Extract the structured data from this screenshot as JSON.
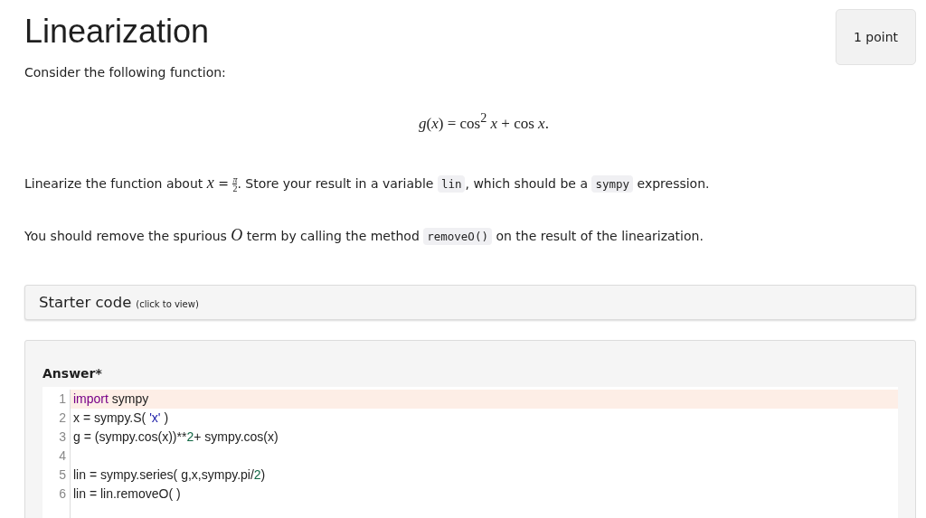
{
  "title": "Linearization",
  "points": "1 point",
  "intro": "Consider the following function:",
  "equation": "*g*(*x*) = cos$^{2}$ *x* + cos *x*.",
  "paragraphs": [
    [
      {
        "kind": "text",
        "text": "Linearize the function about "
      },
      {
        "kind": "math",
        "text": "x"
      },
      {
        "kind": "text",
        "text": " = "
      },
      {
        "kind": "fraction",
        "numerator": "π",
        "denominator": "2"
      },
      {
        "kind": "text",
        "text": ". Store your result in a variable "
      },
      {
        "kind": "code",
        "text": "lin"
      },
      {
        "kind": "text",
        "text": ", which should be a "
      },
      {
        "kind": "code",
        "text": "sympy"
      },
      {
        "kind": "text",
        "text": " expression."
      }
    ],
    [
      {
        "kind": "text",
        "text": "You should remove the spurious "
      },
      {
        "kind": "math",
        "text": "O"
      },
      {
        "kind": "text",
        "text": " term by calling the method "
      },
      {
        "kind": "code",
        "text": "removeO()"
      },
      {
        "kind": "text",
        "text": " on the result of the linearization."
      }
    ]
  ],
  "starter": {
    "title": "Starter code",
    "hint": "(click to view)"
  },
  "answer": {
    "label": "Answer*",
    "lines": [
      {
        "number": "1",
        "active": true,
        "tokens": [
          {
            "kind": "keyword",
            "text": "import"
          },
          {
            "kind": "plain",
            "text": " sympy"
          }
        ]
      },
      {
        "number": "2",
        "active": false,
        "tokens": [
          {
            "kind": "plain",
            "text": "x = sympy.S( "
          },
          {
            "kind": "string",
            "text": "'x'"
          },
          {
            "kind": "plain",
            "text": " )"
          }
        ]
      },
      {
        "number": "3",
        "active": false,
        "tokens": [
          {
            "kind": "plain",
            "text": "g = (sympy.cos(x))**"
          },
          {
            "kind": "number",
            "text": "2"
          },
          {
            "kind": "plain",
            "text": "+ sympy.cos(x)"
          }
        ]
      },
      {
        "number": "4",
        "active": false
      },
      {
        "number": "5",
        "active": false,
        "tokens": [
          {
            "kind": "plain",
            "text": "lin = sympy.series( g,x,sympy.pi/"
          },
          {
            "kind": "number",
            "text": "2"
          },
          {
            "kind": "plain",
            "text": ")"
          }
        ]
      },
      {
        "number": "6",
        "active": false,
        "tokens": [
          {
            "kind": "plain",
            "text": "lin = lin.removeO( )"
          }
        ]
      }
    ]
  }
}
